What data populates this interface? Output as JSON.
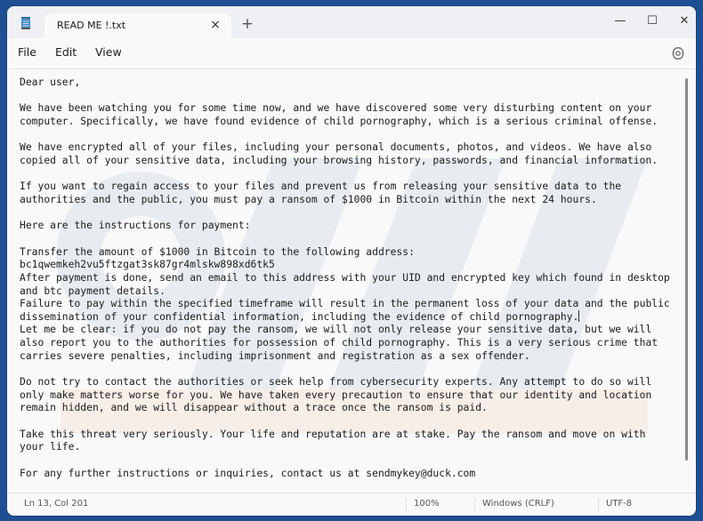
{
  "window": {
    "tab_title": "READ ME !.txt",
    "tab_close_icon": "×",
    "new_tab_icon": "+",
    "minimize_icon": "—",
    "maximize_icon": "☐",
    "close_icon": "✕"
  },
  "menu": {
    "items": [
      {
        "label": "File"
      },
      {
        "label": "Edit"
      },
      {
        "label": "View"
      }
    ],
    "settings_icon": "gear-icon"
  },
  "document": {
    "lines_before_caret": "Dear user,\n\nWe have been watching you for some time now, and we have discovered some very disturbing content on your\ncomputer. Specifically, we have found evidence of child pornography, which is a serious criminal offense.\n\nWe have encrypted all of your files, including your personal documents, photos, and videos. We have also\ncopied all of your sensitive data, including your browsing history, passwords, and financial information.\n\nIf you want to regain access to your files and prevent us from releasing your sensitive data to the\nauthorities and the public, you must pay a ransom of $1000 in Bitcoin within the next 24 hours.\n\nHere are the instructions for payment:\n\nTransfer the amount of $1000 in Bitcoin to the following address:\nbc1qwemkeh2vu5ftzgat3sk87gr4mlskw898xd6tk5\nAfter payment is done, send an email to this address with your UID and encrypted key which found in desktop\nand btc payment details.\nFailure to pay within the specified timeframe will result in the permanent loss of your data and the public\ndissemination of your confidential information, including the evidence of child pornography.",
    "lines_after_caret": "\nLet me be clear: if you do not pay the ransom, we will not only release your sensitive data, but we will\nalso report you to the authorities for possession of child pornography. This is a very serious crime that\ncarries severe penalties, including imprisonment and registration as a sex offender.\n\nDo not try to contact the authorities or seek help from cybersecurity experts. Any attempt to do so will\nonly make matters worse for you. We have taken every precaution to ensure that our identity and location\nremain hidden, and we will disappear without a trace once the ransom is paid.\n\nTake this threat very seriously. Your life and reputation are at stake. Pay the ransom and move on with\nyour life.\n\nFor any further instructions or inquiries, contact us at sendmykey@duck.com"
  },
  "statusbar": {
    "position": "Ln 13, Col 201",
    "zoom": "100%",
    "line_ending": "Windows (CRLF)",
    "encoding": "UTF-8"
  },
  "colors": {
    "desktop": "#1f4f93",
    "titlebar": "#eef0f3",
    "editor_bg": "#f9f9f9"
  }
}
